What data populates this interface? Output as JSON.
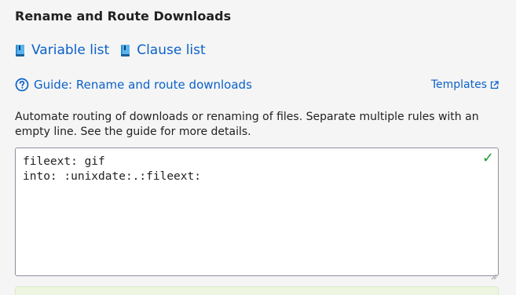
{
  "section": {
    "title": "Rename and Route Downloads"
  },
  "links": {
    "variable_list": "Variable list",
    "clause_list": "Clause list",
    "book_icon": "book-icon"
  },
  "guide": {
    "label": "Guide: Rename and route downloads",
    "icon": "help-circle-icon"
  },
  "templates": {
    "label": "Templates",
    "icon": "external-link-icon"
  },
  "description": "Automate routing of downloads or renaming of files. Separate multiple rules with an empty line. See the guide for more details.",
  "editor": {
    "value": "fileext: gif\ninto: :unixdate:.:fileext:",
    "status_icon": "✓",
    "status_color": "#1a9a2e"
  },
  "colors": {
    "accent": "#0a61c9",
    "success_banner": "#eef6e1"
  }
}
